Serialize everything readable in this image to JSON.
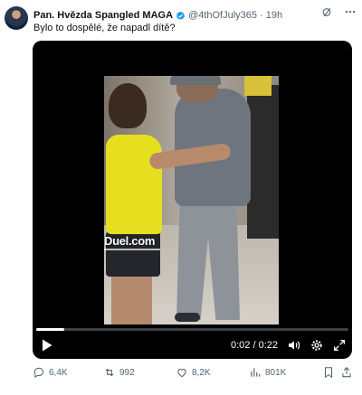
{
  "tweet": {
    "author_name": "Pan. Hvězda Spangled MAGA",
    "handle": "@4thOfJuly365",
    "separator": "·",
    "time": "19h",
    "text": "Bylo to dospělé, že napadl dítě?",
    "verified_color": "#1d9bf0"
  },
  "video": {
    "time_display": "0:02 / 0:22",
    "progress": 0.09,
    "watermark": "Duel.com"
  },
  "actions": {
    "replies": "6,4K",
    "reposts": "992",
    "likes": "8,2K",
    "views": "801K"
  },
  "icons": {
    "grok": "grok-icon",
    "more": "more-icon",
    "play": "play-icon",
    "volume": "volume-icon",
    "settings": "settings-icon",
    "fullscreen": "fullscreen-icon",
    "reply": "reply-icon",
    "repost": "repost-icon",
    "like": "like-icon",
    "views": "views-icon",
    "bookmark": "bookmark-icon",
    "share": "share-icon"
  }
}
